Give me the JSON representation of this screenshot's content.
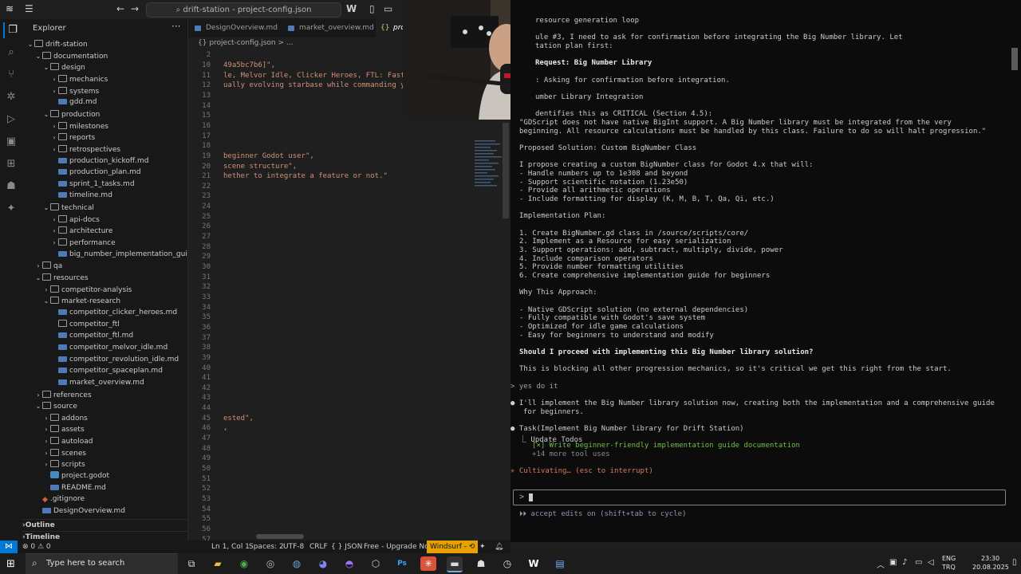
{
  "titlebar": {
    "search_text": "drift-station - project-config.json",
    "icons": [
      "windsurf-logo",
      "menu-icon",
      "back-arrow-icon",
      "forward-arrow-icon",
      "search-icon",
      "w-logo-icon",
      "toggle-sidebar-icon",
      "toggle-panel-icon",
      "layout-icon"
    ],
    "minimize": "─",
    "maximize": "☐",
    "close": "✕"
  },
  "sidebar": {
    "title": "Explorer",
    "more": "···",
    "tree": [
      {
        "label": "drift-station",
        "type": "folder",
        "open": true,
        "depth": 0
      },
      {
        "label": "documentation",
        "type": "folder",
        "open": true,
        "depth": 1
      },
      {
        "label": "design",
        "type": "folder",
        "open": true,
        "depth": 2
      },
      {
        "label": "mechanics",
        "type": "folder",
        "open": false,
        "depth": 3
      },
      {
        "label": "systems",
        "type": "folder",
        "open": false,
        "depth": 3
      },
      {
        "label": "gdd.md",
        "type": "md",
        "depth": 3
      },
      {
        "label": "production",
        "type": "folder",
        "open": true,
        "depth": 2
      },
      {
        "label": "milestones",
        "type": "folder",
        "open": false,
        "depth": 3
      },
      {
        "label": "reports",
        "type": "folder",
        "open": false,
        "depth": 3
      },
      {
        "label": "retrospectives",
        "type": "folder",
        "open": false,
        "depth": 3
      },
      {
        "label": "production_kickoff.md",
        "type": "md",
        "depth": 3
      },
      {
        "label": "production_plan.md",
        "type": "md",
        "depth": 3
      },
      {
        "label": "sprint_1_tasks.md",
        "type": "md",
        "depth": 3
      },
      {
        "label": "timeline.md",
        "type": "md",
        "depth": 3
      },
      {
        "label": "technical",
        "type": "folder",
        "open": true,
        "depth": 2
      },
      {
        "label": "api-docs",
        "type": "folder",
        "open": false,
        "depth": 3
      },
      {
        "label": "architecture",
        "type": "folder",
        "open": false,
        "depth": 3
      },
      {
        "label": "performance",
        "type": "folder",
        "open": false,
        "depth": 3
      },
      {
        "label": "big_number_implementation_guide.md",
        "type": "md",
        "depth": 3
      },
      {
        "label": "qa",
        "type": "folder",
        "open": false,
        "depth": 1
      },
      {
        "label": "resources",
        "type": "folder",
        "open": true,
        "depth": 1
      },
      {
        "label": "competitor-analysis",
        "type": "folder",
        "open": false,
        "depth": 2
      },
      {
        "label": "market-research",
        "type": "folder",
        "open": true,
        "depth": 2
      },
      {
        "label": "competitor_clicker_heroes.md",
        "type": "md",
        "depth": 3
      },
      {
        "label": "competitor_ftl",
        "type": "file",
        "depth": 3
      },
      {
        "label": "competitor_ftl.md",
        "type": "md",
        "depth": 3
      },
      {
        "label": "competitor_melvor_idle.md",
        "type": "md",
        "depth": 3
      },
      {
        "label": "competitor_revolution_idle.md",
        "type": "md",
        "depth": 3
      },
      {
        "label": "competitor_spaceplan.md",
        "type": "md",
        "depth": 3
      },
      {
        "label": "market_overview.md",
        "type": "md",
        "depth": 3
      },
      {
        "label": "references",
        "type": "folder",
        "open": false,
        "depth": 1
      },
      {
        "label": "source",
        "type": "folder",
        "open": true,
        "depth": 1
      },
      {
        "label": "addons",
        "type": "folder",
        "open": false,
        "depth": 2
      },
      {
        "label": "assets",
        "type": "folder",
        "open": false,
        "depth": 2
      },
      {
        "label": "autoload",
        "type": "folder",
        "open": false,
        "depth": 2
      },
      {
        "label": "scenes",
        "type": "folder",
        "open": false,
        "depth": 2
      },
      {
        "label": "scripts",
        "type": "folder",
        "open": false,
        "depth": 2
      },
      {
        "label": "project.godot",
        "type": "godot",
        "depth": 2
      },
      {
        "label": "README.md",
        "type": "md",
        "depth": 2
      },
      {
        "label": ".gitignore",
        "type": "git",
        "depth": 1
      },
      {
        "label": "DesignOverview.md",
        "type": "md",
        "depth": 1
      }
    ],
    "panels": [
      "Outline",
      "Timeline"
    ]
  },
  "editor": {
    "tabs": [
      {
        "label": "DesignOverview.md",
        "active": false
      },
      {
        "label": "market_overview.md",
        "active": false,
        "dirty": "●"
      },
      {
        "label": "proj",
        "active": true
      }
    ],
    "breadcrumb": "{} project-config.json  >  ...",
    "line_numbers": [
      "10",
      "11",
      "12",
      "13",
      "14",
      "15",
      "16",
      "17",
      "18",
      "19",
      "20",
      "21",
      "22",
      "23",
      "24",
      "25",
      "26",
      "27",
      "28",
      "29",
      "30",
      "31",
      "32",
      "33",
      "34",
      "35",
      "36",
      "37",
      "38",
      "39",
      "40",
      "41",
      "42",
      "43",
      "44",
      "45",
      "46",
      "47",
      "48",
      "49",
      "50",
      "51",
      "52",
      "53",
      "54",
      "55",
      "56",
      "57"
    ],
    "first_line_number": "2",
    "code_lines": [
      {
        "line": "10",
        "text": "49a5bc7b6]\","
      },
      {
        "line": "11",
        "text": "le, Melvor Idle, Clicker Heroes, FTL: Faster"
      },
      {
        "line": "12",
        "text": "ually evolving starbase while commanding you"
      },
      {
        "line": "19",
        "text": "beginner Godot user\","
      },
      {
        "line": "20",
        "text": "scene structure\","
      },
      {
        "line": "21",
        "text": "hether to integrate a feature or not.\""
      },
      {
        "line": "45",
        "text": "ested\","
      },
      {
        "line": "46",
        "text": ","
      }
    ]
  },
  "terminal": {
    "lines": [
      {
        "text": "resource generation loop",
        "style": "normal",
        "indent": 20
      },
      {
        "text": "ule #3, I need to ask for confirmation before integrating the Big Number library. Let",
        "style": "normal",
        "indent": 20
      },
      {
        "text": "tation plan first:",
        "style": "normal",
        "indent": 20
      },
      {
        "text": "Request: Big Number Library",
        "style": "bold",
        "indent": 20
      },
      {
        "text": ": Asking for confirmation before integration.",
        "style": "normal",
        "indent": 20
      },
      {
        "text": "umber Library Integration",
        "style": "normal",
        "indent": 20
      },
      {
        "text": "dentifies this as CRITICAL (Section 4.5):",
        "style": "normal",
        "indent": 20
      },
      {
        "text": "\"GDScript does not have native BigInt support. A Big Number library must be integrated from the very",
        "style": "normal",
        "indent": 0
      },
      {
        "text": "beginning. All resource calculations must be handled by this class. Failure to do so will halt progression.\"",
        "style": "normal",
        "indent": 0
      },
      {
        "text": "Proposed Solution: Custom BigNumber Class",
        "style": "normal",
        "indent": 0
      },
      {
        "text": "I propose creating a custom BigNumber class for Godot 4.x that will:",
        "style": "normal",
        "indent": 0
      },
      {
        "text": "- Handle numbers up to 1e308 and beyond",
        "style": "normal",
        "indent": 0
      },
      {
        "text": "- Support scientific notation (1.23e50)",
        "style": "normal",
        "indent": 0
      },
      {
        "text": "- Provide all arithmetic operations",
        "style": "normal",
        "indent": 0
      },
      {
        "text": "- Include formatting for display (K, M, B, T, Qa, Qi, etc.)",
        "style": "normal",
        "indent": 0
      },
      {
        "text": "Implementation Plan:",
        "style": "normal",
        "indent": 0
      },
      {
        "text": "1. Create BigNumber.gd class in /source/scripts/core/",
        "style": "path",
        "indent": 0
      },
      {
        "text": "2. Implement as a Resource for easy serialization",
        "style": "normal",
        "indent": 0
      },
      {
        "text": "3. Support operations: add, subtract, multiply, divide, power",
        "style": "normal",
        "indent": 0
      },
      {
        "text": "4. Include comparison operators",
        "style": "normal",
        "indent": 0
      },
      {
        "text": "5. Provide number formatting utilities",
        "style": "normal",
        "indent": 0
      },
      {
        "text": "6. Create comprehensive implementation guide for beginners",
        "style": "normal",
        "indent": 0
      },
      {
        "text": "Why This Approach:",
        "style": "normal",
        "indent": 0
      },
      {
        "text": "- Native GDScript solution (no external dependencies)",
        "style": "normal",
        "indent": 0
      },
      {
        "text": "- Fully compatible with Godot's save system",
        "style": "normal",
        "indent": 0
      },
      {
        "text": "- Optimized for idle game calculations",
        "style": "normal",
        "indent": 0
      },
      {
        "text": "- Easy for beginners to understand and modify",
        "style": "normal",
        "indent": 0
      },
      {
        "text": "Should I proceed with implementing this Big Number library solution?",
        "style": "bold",
        "indent": 0
      },
      {
        "text": "This is blocking all other progression mechanics, so it's critical we get this right from the start.",
        "style": "normal",
        "indent": 0
      },
      {
        "text": "> yes do it",
        "style": "user",
        "indent": -11
      },
      {
        "text": "● I'll implement the Big Number library solution now, creating both the implementation and a comprehensive guide",
        "style": "normal",
        "indent": -11
      },
      {
        "text": "for beginners.",
        "style": "normal",
        "indent": 5
      },
      {
        "text": "● Task(Implement Big Number library for Drift Station)",
        "style": "normal",
        "indent": -11
      },
      {
        "text": "⎿ Update Todos",
        "style": "normal",
        "indent": 0
      },
      {
        "text": "[×] Write beginner-friendly implementation guide documentation",
        "style": "green",
        "indent": 16
      },
      {
        "text": "+14 more tool uses",
        "style": "dim",
        "indent": 16
      },
      {
        "text": "✳ Cultivating… (esc to interrupt)",
        "style": "orange",
        "indent": -11
      }
    ],
    "prompt_caret": ">",
    "footer": "⏵⏵ accept edits on (shift+tab to cycle)"
  },
  "statusbar": {
    "remote": "⋈",
    "problems": "⊗ 0  ⚠ 0",
    "position": "Ln 1, Col 1",
    "spaces": "Spaces: 2",
    "encoding": "UTF-8",
    "eol": "CRLF",
    "language": "{ } JSON",
    "upgrade": "Free - Upgrade Now",
    "windsurf": "Windsurf - ⟲",
    "bell": "🔔"
  },
  "taskbar": {
    "search_placeholder": "Type here to search",
    "language": "ENG",
    "layout": "TRQ",
    "time": "23:30",
    "date": "20.08.2025",
    "apps": [
      "task-view",
      "file-explorer",
      "chrome",
      "steam-alt",
      "steam",
      "discord",
      "github",
      "unity",
      "photoshop",
      "xmind",
      "terminal",
      "godot",
      "clock",
      "windsurf",
      "app-blue"
    ]
  }
}
